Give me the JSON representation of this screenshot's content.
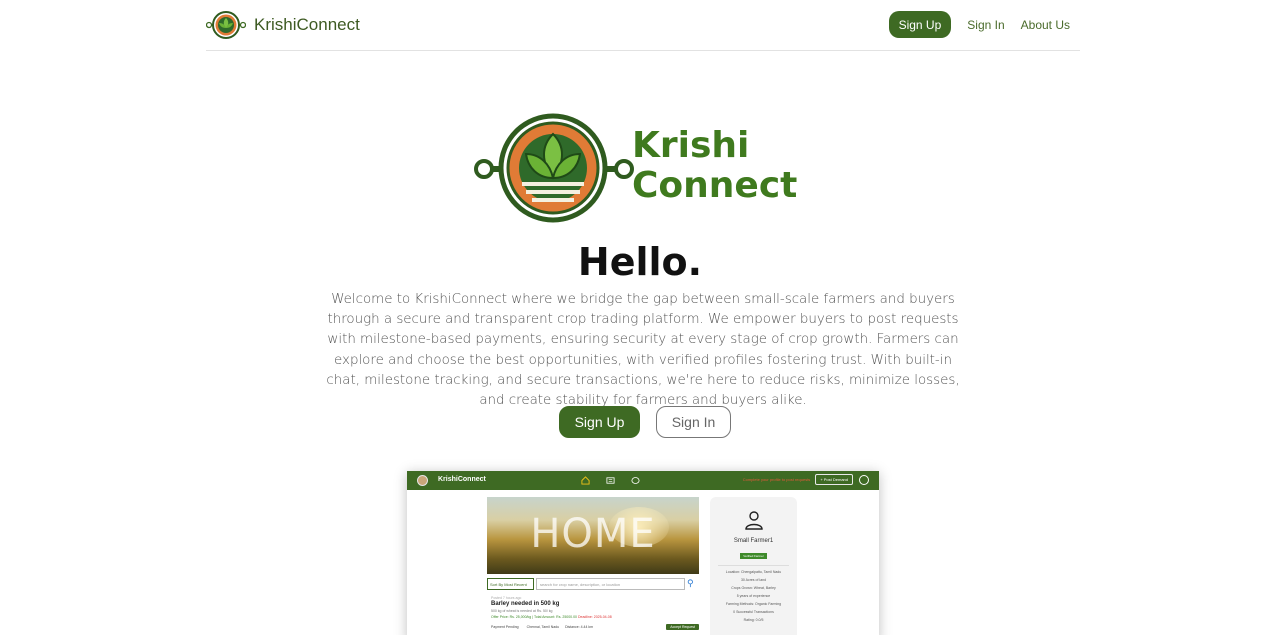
{
  "navbar": {
    "brand": "KrishiConnect",
    "signup_label": "Sign Up",
    "signin_label": "Sign In",
    "about_label": "About Us"
  },
  "hero": {
    "logo_line1": "Krishi",
    "logo_line2": "Connect",
    "heading": "Hello.",
    "intro": "Welcome to KrishiConnect where we bridge the gap between small-scale farmers and buyers through a secure and transparent crop trading platform. We empower buyers to post requests with milestone-based payments, ensuring security at every stage of crop growth. Farmers can explore and choose the best opportunities, with verified profiles fostering trust. With built-in chat, milestone tracking, and secure transactions, we're here to reduce risks, minimize losses, and create stability for farmers and buyers alike.",
    "signup_label": "Sign Up",
    "signin_label": "Sign In"
  },
  "preview": {
    "brand": "KrishiConnect",
    "warning": "Complete your profile to post requests",
    "post_button": "+ Post Demand",
    "hero_text": "HOME",
    "select_label": "Sort By Most Recent",
    "search_placeholder": "search for crop name, description, or location",
    "request": {
      "meta": "Posted 7 hours ago",
      "title": "Barley needed in 500 kg",
      "sub": "500 kg of wheat is needed at Rs. 50/ kg",
      "price_offer": "Offer Price: Rs. 25,000/kg | Total Amount: Rs. 25000.00",
      "price_due": "Deadline: 2025-04-08",
      "status": "Payment Pending",
      "location": "Chennai, Tamil Nadu",
      "distance": "Distance: 4.44 km",
      "accept": "Accept Request"
    },
    "profile": {
      "name": "Small Farmer1",
      "badge": "Verified Farmer",
      "location": "Location: Chengalpattu, Tamil Nadu",
      "land": "30 Acres of land",
      "crops": "Crops Grown: Wheat, Barley",
      "experience": "5 years of experience",
      "method": "Farming Methods: Organic Farming",
      "transactions": "0 Successful Transactions",
      "rating": "Rating: 0.0/5"
    }
  }
}
